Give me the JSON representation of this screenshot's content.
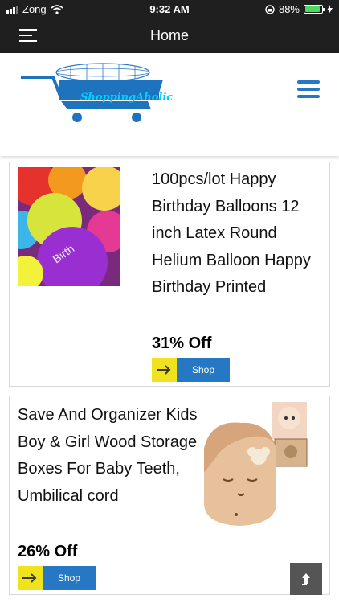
{
  "status_bar": {
    "carrier": "Zong",
    "time": "9:32 AM",
    "battery_percent": "88%"
  },
  "nav": {
    "title": "Home"
  },
  "header": {
    "logo_text": "ShoppingAholic"
  },
  "products": [
    {
      "title": "100pcs/lot Happy Birthday Balloons 12 inch Latex Round Helium Balloon Happy Birthday Printed",
      "discount": "31% Off",
      "button": "Shop"
    },
    {
      "title": "Save And Organizer Kids Boy & Girl Wood Storage Boxes For Baby Teeth, Umbilical cord",
      "discount": "26% Off",
      "button": "Shop"
    }
  ],
  "colors": {
    "accent": "#2677c4",
    "arrow_bg": "#f0e31d",
    "nav_bg": "#1f1f1f"
  }
}
